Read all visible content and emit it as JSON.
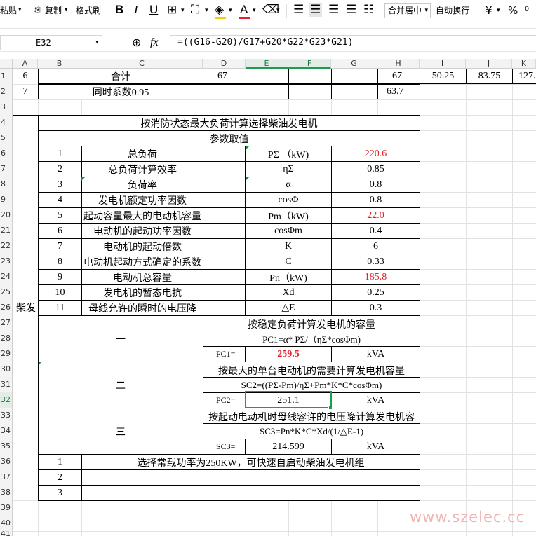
{
  "toolbar": {
    "paste": "粘贴",
    "copy": "复制",
    "format_painter": "格式刷",
    "merge_center": "合并居中",
    "wrap_text": "自动换行",
    "currency": "¥",
    "percent": "%",
    "bold": "B",
    "italic": "I",
    "underline": "U",
    "font_color_letter": "A"
  },
  "formula_bar": {
    "cell_ref": "E32",
    "fx": "fx",
    "formula": "=((G16-G20)/G17+G20*G22*G23*G21)"
  },
  "columns": [
    "A",
    "B",
    "C",
    "D",
    "E",
    "F",
    "G",
    "H",
    "I",
    "J",
    "K"
  ],
  "rows": [
    "1",
    "2",
    "3",
    "4",
    "5",
    "6",
    "7",
    "8",
    "9",
    "20",
    "21",
    "22",
    "23",
    "24",
    "25",
    "26",
    "27",
    "28",
    "29",
    "30",
    "31",
    "32",
    "33",
    "34",
    "35",
    "36",
    "37",
    "38",
    "39",
    "40",
    "41"
  ],
  "top_rows": {
    "r11": {
      "a": "6",
      "c": "合计",
      "d": "67",
      "h": "67",
      "i": "50.25",
      "j": "83.75",
      "k": "127."
    },
    "r12": {
      "a": "7",
      "c": "同时系数0.95",
      "h": "63.7"
    }
  },
  "table": {
    "side_label": "柴发",
    "title": "按消防状态最大负荷计算选择柴油发电机",
    "subtitle": "参数取值",
    "params": [
      {
        "no": "1",
        "name": "总负荷",
        "sym": "PΣ （kW)",
        "val": "220.6",
        "red": true
      },
      {
        "no": "2",
        "name": "总负荷计算效率",
        "sym": "ηΣ",
        "val": "0.85",
        "red": false
      },
      {
        "no": "3",
        "name": "负荷率",
        "sym": "α",
        "val": "0.8",
        "red": false
      },
      {
        "no": "4",
        "name": "发电机额定功率因数",
        "sym": "cosΦ",
        "val": "0.8",
        "red": false
      },
      {
        "no": "5",
        "name": "起动容量最大的电动机容量",
        "sym": "Pm（kW)",
        "val": "22.0",
        "red": true
      },
      {
        "no": "6",
        "name": "电动机的起动功率因数",
        "sym": "cosΦm",
        "val": "0.4",
        "red": false
      },
      {
        "no": "7",
        "name": "电动机的起动倍数",
        "sym": "K",
        "val": "6",
        "red": false
      },
      {
        "no": "8",
        "name": "电动机起动方式确定的系数",
        "sym": "C",
        "val": "0.33",
        "red": false
      },
      {
        "no": "9",
        "name": "电动机总容量",
        "sym": "Pn（kW)",
        "val": "185.8",
        "red": true
      },
      {
        "no": "10",
        "name": "发电机的暂态电抗",
        "sym": "Xd",
        "val": "0.25",
        "red": false
      },
      {
        "no": "11",
        "name": "母线允许的瞬时的电压降",
        "sym": "△E",
        "val": "0.3",
        "red": false
      }
    ],
    "methods": [
      {
        "label": "一",
        "desc": "按稳定负荷计算发电机的容量",
        "formula": "PC1=α* PΣ/（ηΣ*cosΦm)",
        "res_label": "PC1=",
        "res_val": "259.5",
        "unit": "kVA"
      },
      {
        "label": "二",
        "desc": "按最大的单台电动机的需要计算发电机容量",
        "formula": "SC2=((PΣ-Pm)/ηΣ+Pm*K*C*cosΦm)",
        "res_label": "PC2=",
        "res_val": "251.1",
        "unit": "kVA"
      },
      {
        "label": "三",
        "desc": "按起动电动机时母线容许的电压降计算发电机容",
        "formula": "SC3=Pn*K*C*Xd/(1/△E-1)",
        "res_label": "SC3=",
        "res_val": "214.599",
        "unit": "kVA"
      }
    ],
    "conclusions": [
      {
        "no": "1",
        "text": "选择常载功率为250KW，可快速自启动柴油发电机组"
      },
      {
        "no": "2",
        "text": ""
      },
      {
        "no": "3",
        "text": ""
      }
    ]
  },
  "watermark": "www.szelec.cc",
  "colors": {
    "accent": "#1e9b4f",
    "red_value": "#e0242a"
  }
}
